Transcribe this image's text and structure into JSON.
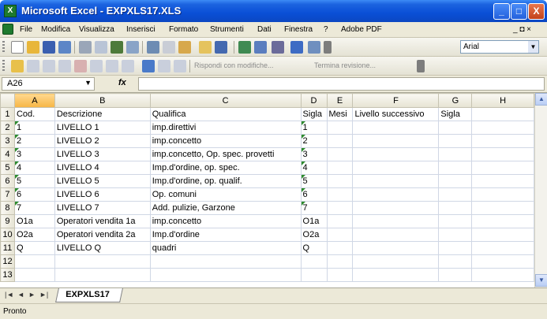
{
  "window": {
    "title": "Microsoft Excel - EXPXLS17.XLS",
    "app_icon": "excel-icon",
    "buttons": {
      "minimize": "_",
      "maximize": "□",
      "close": "X"
    }
  },
  "menu": {
    "items": [
      "File",
      "Modifica",
      "Visualizza",
      "Inserisci",
      "Formato",
      "Strumenti",
      "Dati",
      "Finestra",
      "?",
      "Adobe PDF"
    ],
    "right_controls": "_ ◘ ×"
  },
  "toolbar": {
    "font_name": "Arial",
    "review": {
      "reply_label": "Rispondi con modifiche...",
      "end_label": "Termina revisione..."
    }
  },
  "formula_bar": {
    "name_box": "A26",
    "fx_label": "fx",
    "formula": ""
  },
  "grid": {
    "columns": [
      "",
      "A",
      "B",
      "C",
      "D",
      "E",
      "F",
      "G",
      "H"
    ],
    "rows": [
      [
        "1",
        "Cod.",
        "Descrizione",
        "Qualifica",
        "Sigla",
        "Mesi",
        "Livello successivo",
        "Sigla",
        ""
      ],
      [
        "2",
        "1",
        "LIVELLO  1",
        "imp.direttivi",
        "1",
        "",
        "",
        "",
        ""
      ],
      [
        "3",
        "2",
        "LIVELLO  2",
        "imp.concetto",
        "2",
        "",
        "",
        "",
        ""
      ],
      [
        "4",
        "3",
        "LIVELLO  3",
        "imp.concetto, Op. spec. provetti",
        "3",
        "",
        "",
        "",
        ""
      ],
      [
        "5",
        "4",
        "LIVELLO  4",
        "Imp.d'ordine, op. spec.",
        "4",
        "",
        "",
        "",
        ""
      ],
      [
        "6",
        "5",
        "LIVELLO  5",
        "Imp.d'ordine, op. qualif.",
        "5",
        "",
        "",
        "",
        ""
      ],
      [
        "7",
        "6",
        "LIVELLO  6",
        "Op. comuni",
        "6",
        "",
        "",
        "",
        ""
      ],
      [
        "8",
        "7",
        "LIVELLO  7",
        "Add. pulizie, Garzone",
        "7",
        "",
        "",
        "",
        ""
      ],
      [
        "9",
        "O1a",
        "Operatori vendita 1a",
        "imp.concetto",
        "O1a",
        "",
        "",
        "",
        ""
      ],
      [
        "10",
        "O2a",
        "Operatori vendita 2a",
        "Imp.d'ordine",
        "O2a",
        "",
        "",
        "",
        ""
      ],
      [
        "11",
        "Q",
        "LIVELLO  Q",
        "quadri",
        "Q",
        "",
        "",
        "",
        ""
      ],
      [
        "12",
        "",
        "",
        "",
        "",
        "",
        "",
        "",
        ""
      ],
      [
        "13",
        "",
        "",
        "",
        "",
        "",
        "",
        "",
        ""
      ]
    ],
    "active_column": "A"
  },
  "sheets": {
    "nav": [
      "|◄",
      "◄",
      "►",
      "►|"
    ],
    "active_tab": "EXPXLS17"
  },
  "status": {
    "text": "Pronto"
  }
}
